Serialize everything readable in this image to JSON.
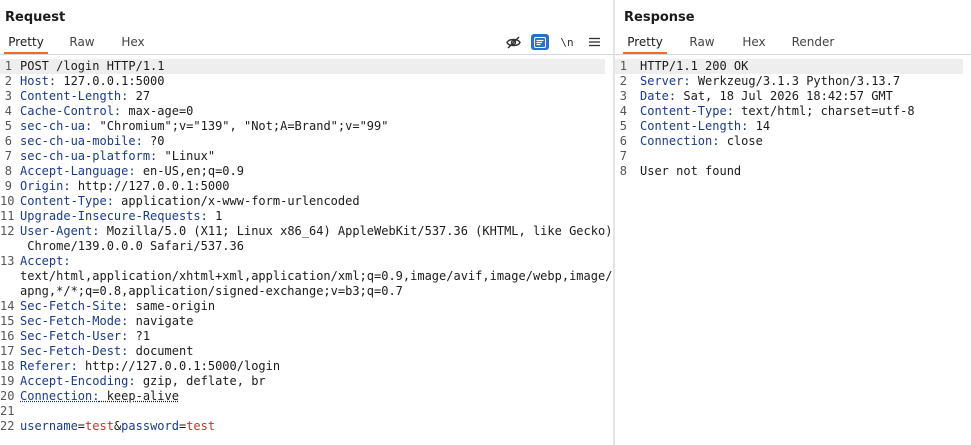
{
  "request": {
    "title": "Request",
    "tabs": [
      "Pretty",
      "Raw",
      "Hex"
    ],
    "toolbar": {
      "hide_icon": "eye-slash-icon",
      "format_icon": "wrap-lines-icon",
      "newline_label": "\\n",
      "menu_icon": "hamburger-menu-icon"
    },
    "lines": [
      {
        "n": "1",
        "text": "POST /login HTTP/1.1"
      },
      {
        "n": "2",
        "k": "Host",
        "v": " 127.0.0.1:5000"
      },
      {
        "n": "3",
        "k": "Content-Length",
        "v": " 27"
      },
      {
        "n": "4",
        "k": "Cache-Control",
        "v": " max-age=0"
      },
      {
        "n": "5",
        "k": "sec-ch-ua",
        "v": " \"Chromium\";v=\"139\", \"Not;A=Brand\";v=\"99\""
      },
      {
        "n": "6",
        "k": "sec-ch-ua-mobile",
        "v": " ?0"
      },
      {
        "n": "7",
        "k": "sec-ch-ua-platform",
        "v": " \"Linux\""
      },
      {
        "n": "8",
        "k": "Accept-Language",
        "v": " en-US,en;q=0.9"
      },
      {
        "n": "9",
        "k": "Origin",
        "v": " http://127.0.0.1:5000"
      },
      {
        "n": "10",
        "k": "Content-Type",
        "v": " application/x-www-form-urlencoded"
      },
      {
        "n": "11",
        "k": "Upgrade-Insecure-Requests",
        "v": " 1"
      },
      {
        "n": "12",
        "k": "User-Agent",
        "v": " Mozilla/5.0 (X11; Linux x86_64) AppleWebKit/537.36 (KHTML, like Gecko)"
      },
      {
        "n": "",
        "text": " Chrome/139.0.0.0 Safari/537.36"
      },
      {
        "n": "13",
        "k": "Accept",
        "v": ""
      },
      {
        "n": "",
        "text": "text/html,application/xhtml+xml,application/xml;q=0.9,image/avif,image/webp,image/"
      },
      {
        "n": "",
        "text": "apng,*/*;q=0.8,application/signed-exchange;v=b3;q=0.7"
      },
      {
        "n": "14",
        "k": "Sec-Fetch-Site",
        "v": " same-origin"
      },
      {
        "n": "15",
        "k": "Sec-Fetch-Mode",
        "v": " navigate"
      },
      {
        "n": "16",
        "k": "Sec-Fetch-User",
        "v": " ?1"
      },
      {
        "n": "17",
        "k": "Sec-Fetch-Dest",
        "v": " document"
      },
      {
        "n": "18",
        "k": "Referer",
        "v": " http://127.0.0.1:5000/login"
      },
      {
        "n": "19",
        "k": "Accept-Encoding",
        "v": " gzip, deflate, br"
      },
      {
        "n": "20",
        "k": "Connection",
        "v": " keep-alive",
        "dotted": true
      },
      {
        "n": "21",
        "text": ""
      },
      {
        "n": "22",
        "body": [
          [
            "username",
            "test"
          ],
          [
            "password",
            "test"
          ]
        ]
      }
    ]
  },
  "response": {
    "title": "Response",
    "tabs": [
      "Pretty",
      "Raw",
      "Hex",
      "Render"
    ],
    "lines": [
      {
        "n": "1",
        "text": "HTTP/1.1 200 OK"
      },
      {
        "n": "2",
        "k": "Server",
        "v": " Werkzeug/3.1.3 Python/3.13.7"
      },
      {
        "n": "3",
        "k": "Date",
        "v": " Sat, 18 Jul 2026 18:42:57 GMT"
      },
      {
        "n": "4",
        "k": "Content-Type",
        "v": " text/html; charset=utf-8"
      },
      {
        "n": "5",
        "k": "Content-Length",
        "v": " 14"
      },
      {
        "n": "6",
        "k": "Connection",
        "v": " close"
      },
      {
        "n": "7",
        "text": ""
      },
      {
        "n": "8",
        "text": "User not found"
      }
    ]
  }
}
